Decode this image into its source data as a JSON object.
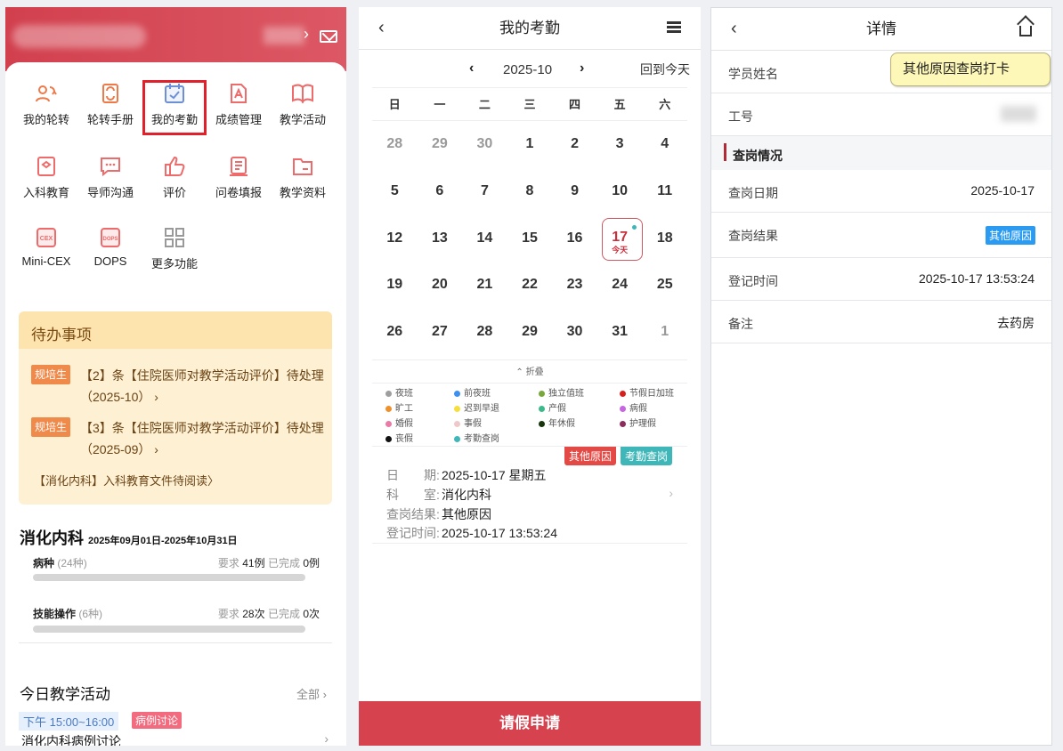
{
  "panel1": {
    "grid_items": [
      {
        "label": "我的轮转",
        "icon": "rotation-icon"
      },
      {
        "label": "轮转手册",
        "icon": "handbook-icon"
      },
      {
        "label": "我的考勤",
        "icon": "calendar-check-icon"
      },
      {
        "label": "成绩管理",
        "icon": "grade-icon"
      },
      {
        "label": "教学活动",
        "icon": "book-icon"
      },
      {
        "label": "入科教育",
        "icon": "education-icon"
      },
      {
        "label": "导师沟通",
        "icon": "chat-icon"
      },
      {
        "label": "评价",
        "icon": "thumbs-up-icon"
      },
      {
        "label": "问卷填报",
        "icon": "survey-icon"
      },
      {
        "label": "教学资料",
        "icon": "folder-icon"
      },
      {
        "label": "Mini-CEX",
        "icon": "cex-icon"
      },
      {
        "label": "DOPS",
        "icon": "dops-icon"
      },
      {
        "label": "更多功能",
        "icon": "more-grid-icon"
      }
    ],
    "todo": {
      "title": "待办事项",
      "items": [
        {
          "tag": "规培生",
          "text": "【2】条【住院医师对教学活动评价】待处理（2025-10）",
          "chev": "›"
        },
        {
          "tag": "规培生",
          "text": "【3】条【住院医师对教学活动评价】待处理（2025-09）",
          "chev": "›"
        }
      ],
      "link": "【消化内科】入科教育文件待阅读〉"
    },
    "dept": {
      "name": "消化内科",
      "period": "2025年09月01日-2025年10月31日"
    },
    "progress": [
      {
        "name": "病种",
        "count": "(24种)",
        "req_label": "要求",
        "req": "41例",
        "done_label": "已完成",
        "done": "0例",
        "fraction": 0
      },
      {
        "name": "技能操作",
        "count": "(6种)",
        "req_label": "要求",
        "req": "28次",
        "done_label": "已完成",
        "done": "0次",
        "fraction": 0
      }
    ],
    "activity": {
      "title": "今日教学活动",
      "all_label": "全部",
      "time": "下午 15:00~16:00",
      "type": "病例讨论",
      "name": "消化内科病例讨论"
    }
  },
  "panel2": {
    "title": "我的考勤",
    "month": "2025-10",
    "today_label": "回到今天",
    "weekdays": [
      "日",
      "一",
      "二",
      "三",
      "四",
      "五",
      "六"
    ],
    "days": [
      "28",
      "29",
      "30",
      "1",
      "2",
      "3",
      "4",
      "5",
      "6",
      "7",
      "8",
      "9",
      "10",
      "11",
      "12",
      "13",
      "14",
      "15",
      "16",
      "17",
      "18",
      "19",
      "20",
      "21",
      "22",
      "23",
      "24",
      "25",
      "26",
      "27",
      "28",
      "29",
      "30",
      "31",
      "1"
    ],
    "off_days_index": [
      0,
      1,
      2,
      34
    ],
    "today_index": 19,
    "today_sub": "今天",
    "fold_label": "⌃ 折叠",
    "legend": [
      {
        "label": "夜班",
        "color": "#9e9e9e"
      },
      {
        "label": "前夜班",
        "color": "#3d8ff0"
      },
      {
        "label": "独立值班",
        "color": "#78a83c"
      },
      {
        "label": "节假日加班",
        "color": "#d6201e"
      },
      {
        "label": "旷工",
        "color": "#f0902a"
      },
      {
        "label": "迟到早退",
        "color": "#f6df3c"
      },
      {
        "label": "产假",
        "color": "#3cba8c"
      },
      {
        "label": "病假",
        "color": "#c666e0"
      },
      {
        "label": "婚假",
        "color": "#ea7ba6"
      },
      {
        "label": "事假",
        "color": "#efc9c9"
      },
      {
        "label": "年休假",
        "color": "#17360b"
      },
      {
        "label": "护理假",
        "color": "#8c2d5e"
      },
      {
        "label": "丧假",
        "color": "#111111"
      },
      {
        "label": "考勤查岗",
        "color": "#3fb6b8"
      }
    ],
    "record": {
      "tag1": "其他原因",
      "tag2": "考勤查岗",
      "rows": [
        {
          "k": "日　　期:",
          "v": "2025-10-17 星期五"
        },
        {
          "k": "科　　室:",
          "v": "消化内科"
        },
        {
          "k": "查岗结果:",
          "v": "其他原因"
        },
        {
          "k": "登记时间:",
          "v": "2025-10-17 13:53:24"
        }
      ]
    },
    "leave_button": "请假申请"
  },
  "panel3": {
    "title": "详情",
    "tooltip": "其他原因查岗打卡",
    "student_label": "学员姓名",
    "id_label": "工号",
    "section": "查岗情况",
    "rows": [
      {
        "k": "查岗日期",
        "v": "2025-10-17"
      },
      {
        "k": "查岗结果",
        "v": "其他原因"
      },
      {
        "k": "登记时间",
        "v": "2025-10-17 13:53:24"
      },
      {
        "k": "备注",
        "v": "去药房"
      }
    ]
  }
}
